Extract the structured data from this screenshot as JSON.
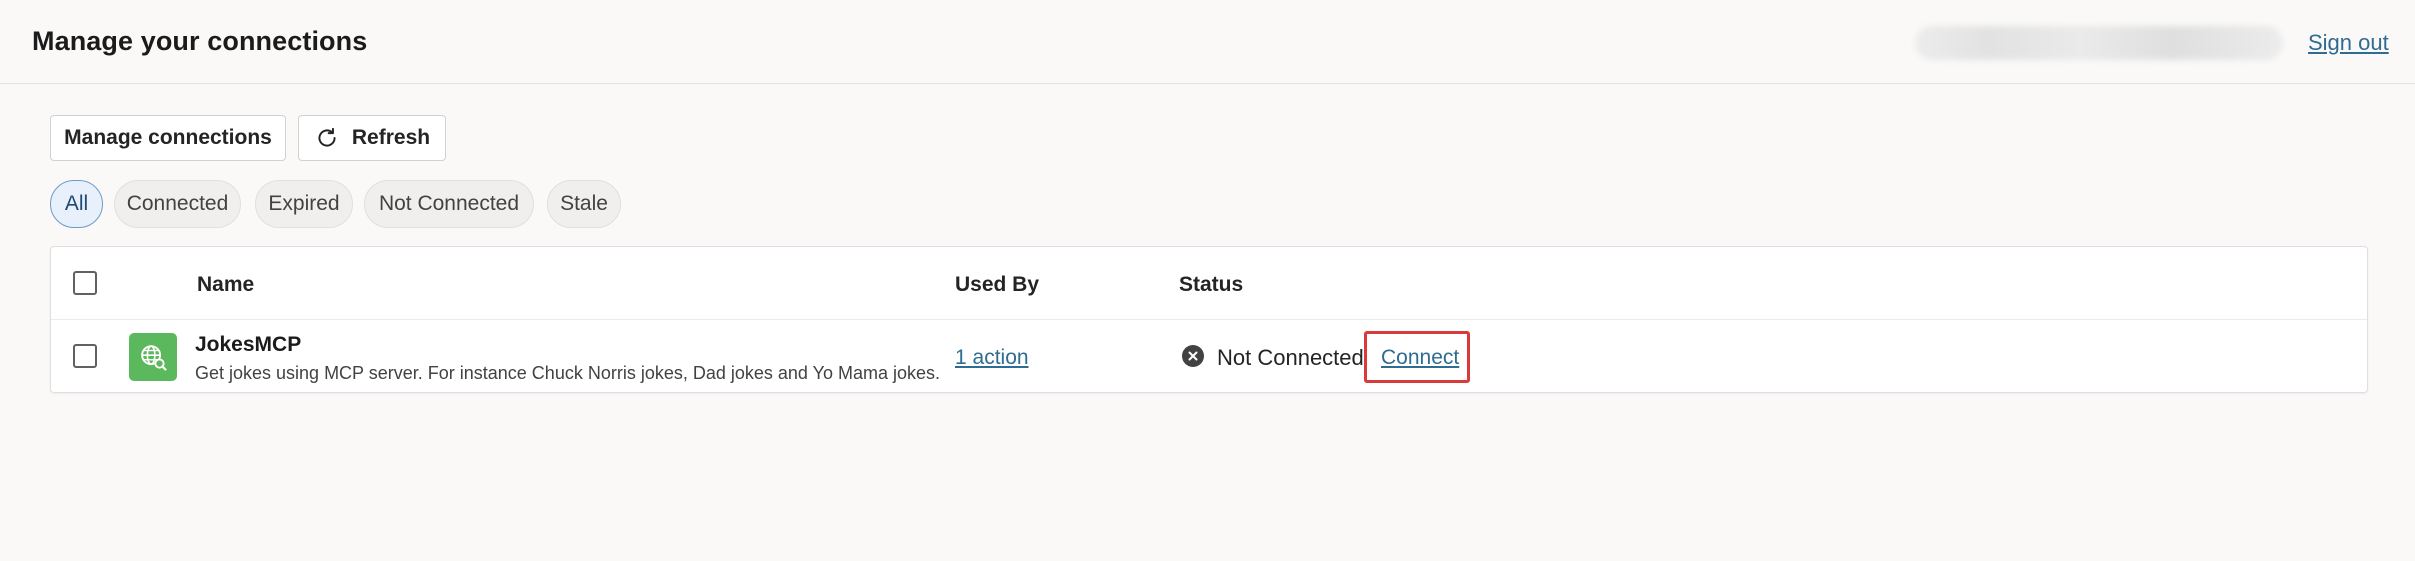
{
  "header": {
    "title": "Manage your connections",
    "sign_out_label": "Sign out"
  },
  "toolbar": {
    "manage_label": "Manage connections",
    "refresh_label": "Refresh"
  },
  "filters": [
    {
      "label": "All",
      "active": true
    },
    {
      "label": "Connected",
      "active": false
    },
    {
      "label": "Expired",
      "active": false
    },
    {
      "label": "Not Connected",
      "active": false
    },
    {
      "label": "Stale",
      "active": false
    }
  ],
  "table": {
    "columns": [
      "Name",
      "Used By",
      "Status"
    ],
    "rows": [
      {
        "icon": "globe-search-icon",
        "name": "JokesMCP",
        "description": "Get jokes using MCP server. For instance Chuck Norris jokes, Dad jokes and Yo Mama jokes.",
        "used_by": "1 action",
        "status": "Not Connected",
        "status_icon": "close-circle-icon",
        "action_label": "Connect"
      }
    ]
  },
  "colors": {
    "accent_link": "#2f6c91",
    "app_icon_bg": "#5cb85c",
    "highlight_border": "#d93a3a"
  }
}
